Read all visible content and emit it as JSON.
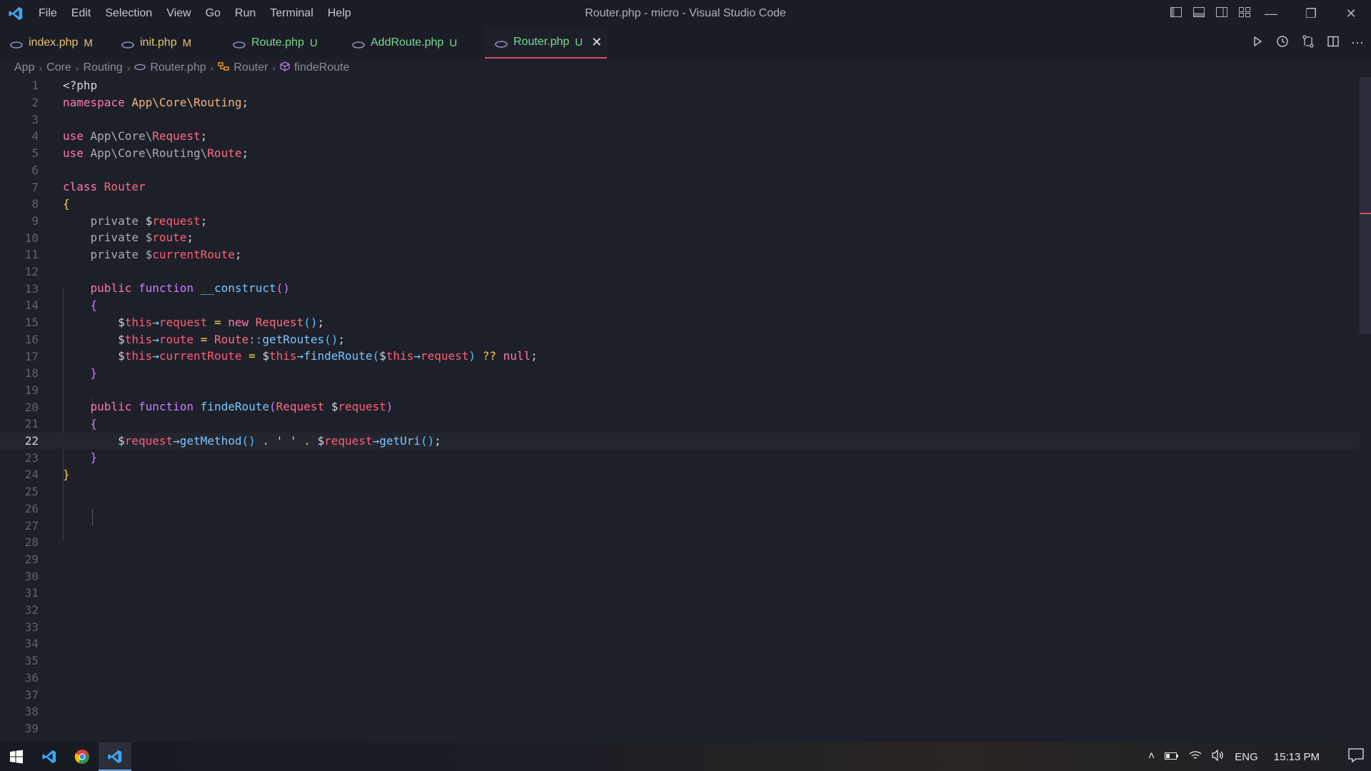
{
  "window": {
    "title": "Router.php - micro - Visual Studio Code",
    "menu": [
      "File",
      "Edit",
      "Selection",
      "View",
      "Go",
      "Run",
      "Terminal",
      "Help"
    ]
  },
  "tabs": [
    {
      "label": "index.php",
      "status": "M",
      "color": "#e9c46a",
      "active": false
    },
    {
      "label": "init.php",
      "status": "M",
      "color": "#e9c46a",
      "active": false
    },
    {
      "label": "Route.php",
      "status": "U",
      "color": "#7bd88f",
      "active": false
    },
    {
      "label": "AddRoute.php",
      "status": "U",
      "color": "#7bd88f",
      "active": false
    },
    {
      "label": "Router.php",
      "status": "U",
      "color": "#7bd88f",
      "active": true
    }
  ],
  "breadcrumb": {
    "segments": [
      "App",
      "Core",
      "Routing",
      "Router.php",
      "Router",
      "findeRoute"
    ]
  },
  "editor": {
    "current_line": 22,
    "line_count": 39
  },
  "taskbar": {
    "tray_language": "ENG",
    "clock": "15:13 PM"
  },
  "colors": {
    "accent": "#e2466a",
    "modified": "#e9c46a",
    "untracked": "#7bd88f",
    "background": "#1e2029"
  }
}
